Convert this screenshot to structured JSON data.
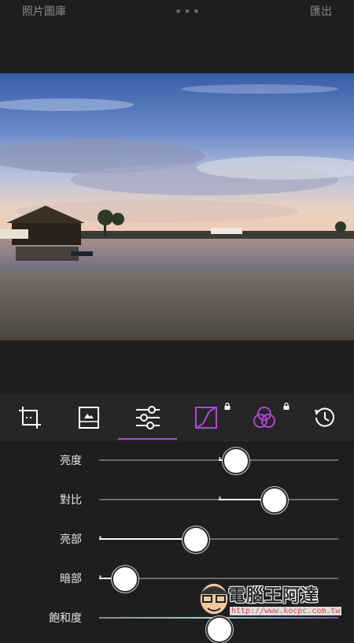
{
  "header": {
    "left_label": "照片圖庫",
    "more_label": "•••",
    "right_label": "匯出"
  },
  "toolbar": {
    "tools": [
      {
        "id": "crop",
        "icon": "crop-icon"
      },
      {
        "id": "image",
        "icon": "image-icon"
      },
      {
        "id": "adjust",
        "icon": "sliders-icon",
        "active": true
      },
      {
        "id": "curves",
        "icon": "curves-icon",
        "locked": true
      },
      {
        "id": "color",
        "icon": "color-circles-icon",
        "locked": true
      },
      {
        "id": "history",
        "icon": "history-icon"
      }
    ],
    "accent_color": "#b044d8"
  },
  "sliders": [
    {
      "label": "亮度",
      "value": 0.57,
      "center": 0.5
    },
    {
      "label": "對比",
      "value": 0.73,
      "center": 0.5
    },
    {
      "label": "亮部",
      "value": 0.4,
      "center": 0.0
    },
    {
      "label": "暗部",
      "value": 0.1,
      "center": 0.0
    },
    {
      "label": "飽和度",
      "value": 0.5,
      "center": 0.5
    }
  ],
  "watermark": {
    "title": "電腦王阿達",
    "url": "http://www.kocpc.com.tw"
  }
}
